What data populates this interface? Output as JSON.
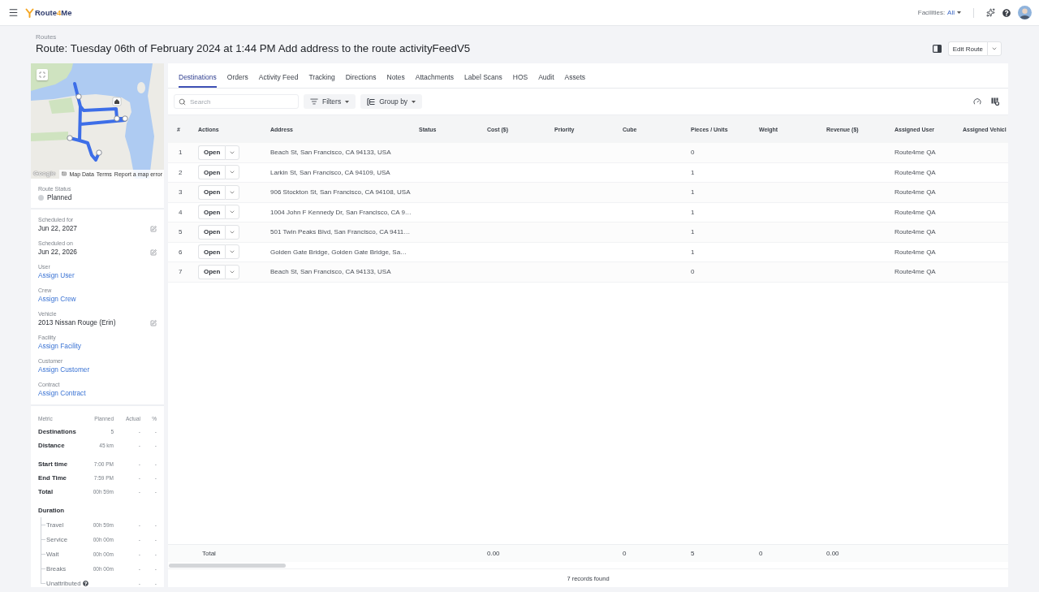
{
  "topbar": {
    "brand": [
      {
        "text": "Route",
        "accent": false
      },
      {
        "text": "4",
        "accent": true
      },
      {
        "text": "Me",
        "accent": false
      }
    ],
    "facilities": {
      "label": "Facilities:",
      "value": "All"
    }
  },
  "header": {
    "breadcrumb": "Routes",
    "title": "Route: Tuesday 06th of February 2024 at 1:44 PM Add address to the route activityFeedV5",
    "edit_button": "Edit Route"
  },
  "map": {
    "logo": "Google",
    "links": [
      "Map Data",
      "Terms",
      "Report a map error"
    ]
  },
  "route_status": {
    "label": "Route Status",
    "value": "Planned"
  },
  "details": [
    {
      "label": "Scheduled for",
      "value": "Jun 22, 2027",
      "kind": "text",
      "editable": true
    },
    {
      "label": "Scheduled on",
      "value": "Jun 22, 2026",
      "kind": "text",
      "editable": true
    },
    {
      "label": "User",
      "value": "Assign User",
      "kind": "link",
      "editable": false
    },
    {
      "label": "Crew",
      "value": "Assign Crew",
      "kind": "link",
      "editable": false
    },
    {
      "label": "Vehicle",
      "value": "2013 Nissan Rouge (Erin)",
      "kind": "text",
      "editable": true
    },
    {
      "label": "Facility",
      "value": "Assign Facility",
      "kind": "link",
      "editable": false
    },
    {
      "label": "Customer",
      "value": "Assign Customer",
      "kind": "link",
      "editable": false
    },
    {
      "label": "Contract",
      "value": "Assign Contract",
      "kind": "link",
      "editable": false
    }
  ],
  "metrics": {
    "columns": [
      "Metric",
      "Planned",
      "Actual",
      "%"
    ],
    "sections": [
      {
        "rows": [
          {
            "label": "Destinations",
            "planned": "5",
            "actual": "-",
            "percent": "-"
          },
          {
            "label": "Distance",
            "planned": "45 km",
            "actual": "-",
            "percent": "-"
          }
        ]
      },
      {
        "rows": [
          {
            "label": "Start time",
            "planned": "7:00 PM",
            "actual": "-",
            "percent": "-"
          },
          {
            "label": "End Time",
            "planned": "7:59 PM",
            "actual": "-",
            "percent": "-"
          },
          {
            "label": "Total",
            "planned": "00h 59m",
            "actual": "-",
            "percent": "-"
          }
        ]
      },
      {
        "rows": [
          {
            "label": "Duration",
            "children": [
              {
                "label": "Travel",
                "planned": "00h 59m",
                "actual": "-",
                "percent": "-",
                "help": false
              },
              {
                "label": "Service",
                "planned": "00h 00m",
                "actual": "-",
                "percent": "-",
                "help": false
              },
              {
                "label": "Wait",
                "planned": "00h 00m",
                "actual": "-",
                "percent": "-",
                "help": false
              },
              {
                "label": "Breaks",
                "planned": "00h 00m",
                "actual": "-",
                "percent": "-",
                "help": false
              },
              {
                "label": "Unattributed",
                "actual": "-",
                "percent": "-",
                "help": true
              }
            ]
          }
        ]
      }
    ]
  },
  "tabs": [
    {
      "label": "Destinations",
      "selected": true
    },
    {
      "label": "Orders",
      "selected": false
    },
    {
      "label": "Activity Feed",
      "selected": false
    },
    {
      "label": "Tracking",
      "selected": false
    },
    {
      "label": "Directions",
      "selected": false
    },
    {
      "label": "Notes",
      "selected": false
    },
    {
      "label": "Attachments",
      "selected": false
    },
    {
      "label": "Label Scans",
      "selected": false
    },
    {
      "label": "HOS",
      "selected": false
    },
    {
      "label": "Audit",
      "selected": false
    },
    {
      "label": "Assets",
      "selected": false
    }
  ],
  "toolbar": {
    "search": {
      "placeholder": "Search"
    },
    "filters": "Filters",
    "group_by": "Group by"
  },
  "table": {
    "columns": [
      "#",
      "Actions",
      "Address",
      "Status",
      "Cost ($)",
      "Priority",
      "Cube",
      "Pieces / Units",
      "Weight",
      "Revenue ($)",
      "Assigned User",
      "Assigned Vehicl"
    ],
    "rows": [
      {
        "number": "1",
        "action": "Open",
        "address": "Beach St, San Francisco, CA 94133, USA",
        "pieces_units": "0",
        "assigned_user": "Route4me QA"
      },
      {
        "number": "2",
        "action": "Open",
        "address": "Larkin St, San Francisco, CA 94109, USA",
        "pieces_units": "1",
        "assigned_user": "Route4me QA"
      },
      {
        "number": "3",
        "action": "Open",
        "address": "906 Stockton St, San Francisco, CA 94108, USA",
        "pieces_units": "1",
        "assigned_user": "Route4me QA"
      },
      {
        "number": "4",
        "action": "Open",
        "address": "1004 John F Kennedy Dr, San Francisco, CA 9…",
        "pieces_units": "1",
        "assigned_user": "Route4me QA"
      },
      {
        "number": "5",
        "action": "Open",
        "address": "501 Twin Peaks Blvd, San Francisco, CA 9411…",
        "pieces_units": "1",
        "assigned_user": "Route4me QA"
      },
      {
        "number": "6",
        "action": "Open",
        "address": "Golden Gate Bridge, Golden Gate Bridge, Sa…",
        "pieces_units": "1",
        "assigned_user": "Route4me QA"
      },
      {
        "number": "7",
        "action": "Open",
        "address": "Beach St, San Francisco, CA 94133, USA",
        "pieces_units": "0",
        "assigned_user": "Route4me QA"
      }
    ],
    "total": {
      "label": "Total",
      "cost": "0.00",
      "cube": "0",
      "pieces_units": "5",
      "weight": "0",
      "revenue": "0.00"
    }
  },
  "footer": {
    "records": "7 records found"
  }
}
